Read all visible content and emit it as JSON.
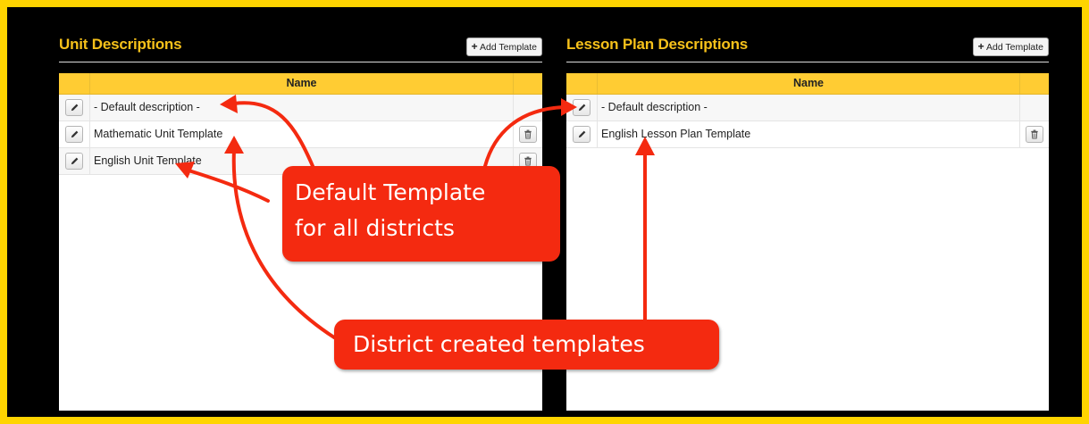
{
  "colors": {
    "frame": "#ffd400",
    "background": "#000000",
    "panel_title": "#f6c11a",
    "table_header": "#ffcc33",
    "callout": "#f42a10"
  },
  "left_panel": {
    "title": "Unit Descriptions",
    "add_button_label": "Add Template",
    "column_header": "Name",
    "rows": [
      {
        "name": "- Default description -",
        "deletable": false
      },
      {
        "name": "Mathematic Unit Template",
        "deletable": true
      },
      {
        "name": "English Unit Template",
        "deletable": true
      }
    ]
  },
  "right_panel": {
    "title": "Lesson Plan Descriptions",
    "add_button_label": "Add Template",
    "column_header": "Name",
    "rows": [
      {
        "name": "- Default description -",
        "deletable": false
      },
      {
        "name": "English Lesson Plan Template",
        "deletable": true
      }
    ]
  },
  "annotations": {
    "default_callout_line1": "Default Template",
    "default_callout_line2": "for all districts",
    "district_callout": "District created templates"
  },
  "icons": {
    "edit": "pencil-icon",
    "delete": "trash-icon",
    "add": "plus-icon"
  }
}
